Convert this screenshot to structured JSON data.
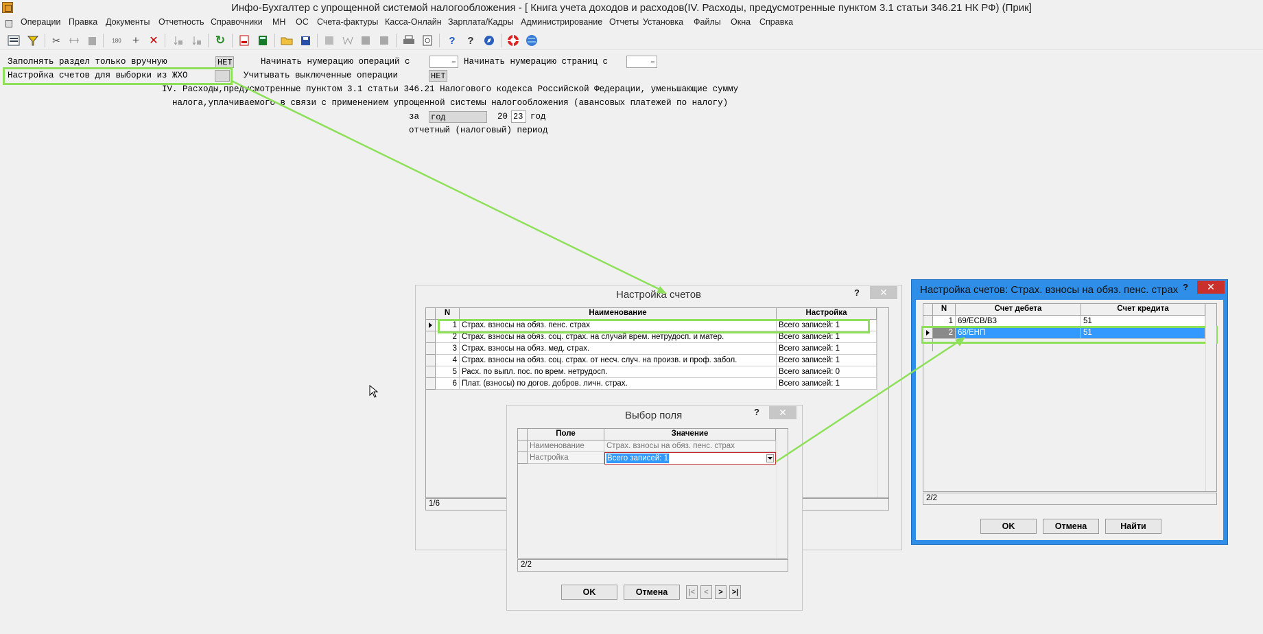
{
  "window": {
    "title": "Инфо-Бухгалтер с упрощенной системой налогообложения - [    Книга учета доходов и расходов(IV. Расходы, предусмотренные пунктом 3.1 статьи 346.21 НК РФ) (Прик]"
  },
  "menu": [
    "Операции",
    "Правка",
    "Документы",
    "Отчетность",
    "Справочники",
    "МН",
    "ОС",
    "Счета-фактуры",
    "Касса-Онлайн",
    "Зарплата/Кадры",
    "Администрирование",
    "Отчеты",
    "Установка",
    "Файлы",
    "Окна",
    "Справка"
  ],
  "toolbar": {
    "icons": [
      "form-icon",
      "filter-icon",
      "cut-icon",
      "link-icon",
      "paste-icon",
      "rotate-icon",
      "add-icon",
      "delete-icon",
      "sort-icon",
      "sort-ab-icon",
      "refresh-icon",
      "pdf-icon",
      "calculator-icon",
      "open-folder-icon",
      "save-icon",
      "image-icon",
      "word-icon",
      "grey-icon-1",
      "grey-icon-2",
      "print-icon",
      "preview-icon",
      "help-icon",
      "context-help-icon",
      "compass-icon",
      "lifebuoy-icon",
      "globe-icon"
    ],
    "glyphs": {
      "cut": "✂",
      "add": "+",
      "delete": "✕",
      "refresh": "↻",
      "help": "?",
      "context_help": "?",
      "filter": "▼",
      "rotate": "180"
    }
  },
  "form": {
    "fill_manual_label": "Заполнять раздел только вручную",
    "fill_manual_value": "НЕТ",
    "start_ops_label": "Начинать нумерацию операций с",
    "start_ops_value": "",
    "start_pages_label": "Начинать нумерацию страниц с",
    "start_pages_value": "",
    "accounts_settings_label": "Настройка счетов для выборки из ЖХО",
    "accounts_settings_value": "",
    "consider_disabled_label": "Учитывать выключенные операции",
    "consider_disabled_value": "НЕТ",
    "heading_line1": "IV. Расходы,предусмотренные пунктом 3.1 статьи 346.21 Налогового кодекса Российской Федерации, уменьшающие сумму",
    "heading_line2": "налога,уплачиваемого в связи с применением упрощенной системы налогообложения (авансовых платежей по налогу)",
    "period_prefix": "за",
    "period_value": "год",
    "year_prefix": "20",
    "year_value": "23",
    "year_suffix": "год",
    "period_caption": "отчетный (налоговый) период",
    "dash": "–"
  },
  "dialog_accounts": {
    "title": "Настройка счетов",
    "help": "?",
    "close": "✕",
    "columns": [
      "N",
      "Наименование",
      "Настройка"
    ],
    "rows": [
      {
        "n": "1",
        "name": "Страх. взносы на обяз. пенс. страх",
        "setting": "Всего записей: 1"
      },
      {
        "n": "2",
        "name": "Страх. взносы на обяз. соц. страх. на случай врем. нетрудосп. и матер.",
        "setting": "Всего записей: 1"
      },
      {
        "n": "3",
        "name": "Страх. взносы на обяз. мед. страх.",
        "setting": "Всего записей: 1"
      },
      {
        "n": "4",
        "name": "Страх. взносы на обяз. соц. страх. от несч. случ. на произв. и проф. забол.",
        "setting": "Всего записей: 1"
      },
      {
        "n": "5",
        "name": "Расх. по выпл. пос. по врем. нетрудосп.",
        "setting": "Всего записей: 0"
      },
      {
        "n": "6",
        "name": "Плат. (взносы) по догов. добров. личн. страх.",
        "setting": "Всего записей: 1"
      }
    ],
    "status": "1/6"
  },
  "dialog_field": {
    "title": "Выбор поля",
    "help": "?",
    "close": "✕",
    "columns": [
      "Поле",
      "Значение"
    ],
    "rows": [
      {
        "field": "Наименование",
        "value": "Страх. взносы на обяз. пенс. страх"
      },
      {
        "field": "Настройка",
        "value": "Всего записей: 1"
      }
    ],
    "status": "2/2",
    "ok": "OK",
    "cancel": "Отмена",
    "nav": [
      "|<",
      "<",
      ">",
      ">|"
    ]
  },
  "dialog_pension": {
    "title": "Настройка счетов: Страх. взносы на обяз. пенс. страх",
    "help": "?",
    "close": "✕",
    "columns": [
      "N",
      "Счет дебета",
      "Счет кредита"
    ],
    "rows": [
      {
        "n": "1",
        "debit": "69/ЕСВ/ВЗ",
        "credit": "51"
      },
      {
        "n": "2",
        "debit": "68/ЕНП",
        "credit": "51"
      }
    ],
    "status": "2/2",
    "ok": "OK",
    "cancel": "Отмена",
    "find": "Найти"
  },
  "colors": {
    "highlight": "#8ee05a",
    "selection": "#3399ff",
    "active_dialog_border": "#2f8fe8",
    "close_red": "#c9302c"
  }
}
